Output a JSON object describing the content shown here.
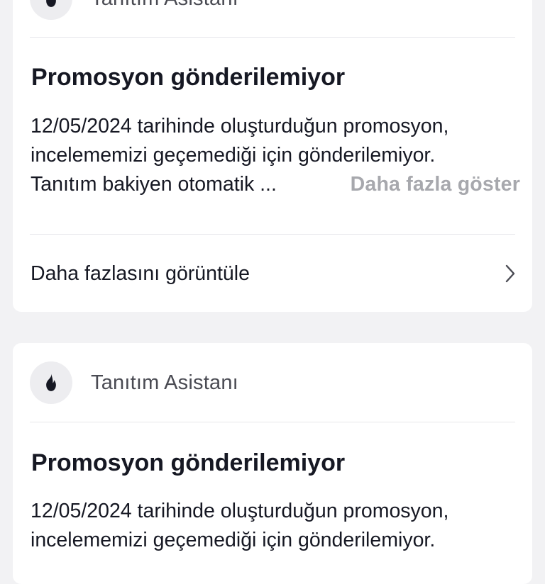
{
  "colors": {
    "page_background": "#f2f2f4",
    "card_background": "#ffffff",
    "text_primary": "#161823",
    "text_secondary": "#4a4b53",
    "text_muted": "#a7a8ad",
    "divider": "#e6e6ea",
    "avatar_background": "#ededf0"
  },
  "notifications": [
    {
      "sender": "Tanıtım Asistanı",
      "avatar_icon": "flame-icon",
      "title": "Promosyon gönderilemiyor",
      "body_lines": [
        "12/05/2024 tarihinde oluşturduğun promosyon,",
        "incelememizi geçemediği için gönderilemiyor.",
        "Tanıtım bakiyen otomatik ..."
      ],
      "show_more_label": "Daha fazla göster",
      "view_more_label": "Daha fazlasını görüntüle",
      "view_more_icon": "chevron-right-icon"
    },
    {
      "sender": "Tanıtım Asistanı",
      "avatar_icon": "flame-icon",
      "title": "Promosyon gönderilemiyor",
      "body_lines": [
        "12/05/2024 tarihinde oluşturduğun promosyon,",
        "incelememizi geçemediği için gönderilemiyor."
      ]
    }
  ]
}
